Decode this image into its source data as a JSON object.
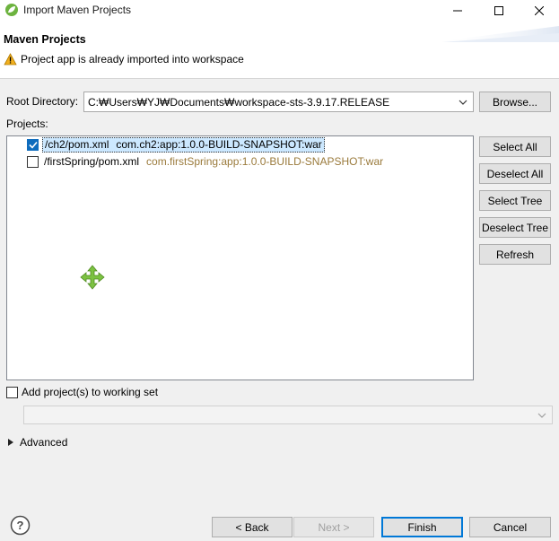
{
  "window": {
    "title": "Import Maven Projects"
  },
  "header": {
    "title": "Maven Projects",
    "message": "Project app is already imported into workspace"
  },
  "root_directory": {
    "label": "Root Directory:",
    "value": "C:₩Users₩YJ₩Documents₩workspace-sts-3.9.17.RELEASE",
    "browse_label": "Browse..."
  },
  "projects": {
    "label": "Projects:",
    "items": [
      {
        "path": "/ch2/pom.xml",
        "artifact": "com.ch2:app:1.0.0-BUILD-SNAPSHOT:war",
        "checked": true,
        "selected": true
      },
      {
        "path": "/firstSpring/pom.xml",
        "artifact": "com.firstSpring:app:1.0.0-BUILD-SNAPSHOT:war",
        "checked": false,
        "selected": false
      }
    ]
  },
  "side_buttons": {
    "select_all": "Select All",
    "deselect_all": "Deselect All",
    "select_tree": "Select Tree",
    "deselect_tree": "Deselect Tree",
    "refresh": "Refresh"
  },
  "working_set": {
    "label": "Add project(s) to working set",
    "checked": false
  },
  "advanced": {
    "label": "Advanced"
  },
  "footer": {
    "back": "< Back",
    "next": "Next >",
    "finish": "Finish",
    "cancel": "Cancel"
  },
  "colors": {
    "accent": "#0078d7",
    "warning": "#f2b01e",
    "move_icon": "#7cc242",
    "artifact_muted": "#9a7a3b"
  }
}
